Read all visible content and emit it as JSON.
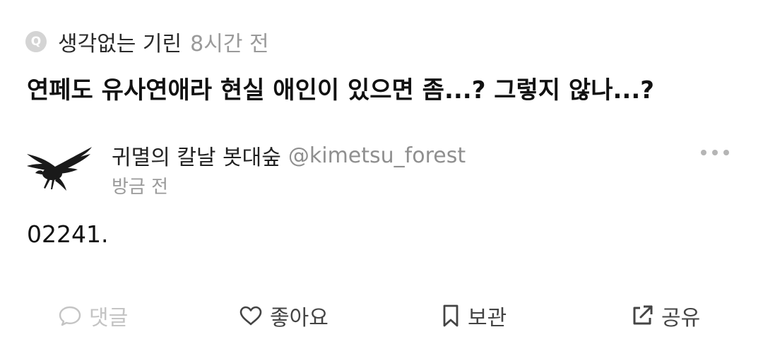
{
  "question": {
    "badge": "Q",
    "asker": "생각없는 기린",
    "time": "8시간 전",
    "text": "연페도 유사연애라 현실 애인이 있으면 좀...? 그렇지 않나...?"
  },
  "answer": {
    "author_name": "귀멸의 칼날 봇대숲",
    "author_handle": "@kimetsu_forest",
    "time": "방금 전",
    "text": "02241.",
    "avatar_icon": "crow-silhouette"
  },
  "actions": {
    "comment_label": "댓글",
    "like_label": "좋아요",
    "save_label": "보관",
    "share_label": "공유"
  },
  "colors": {
    "badge_bg": "#d4d4d4",
    "muted_text": "#9a9a9a",
    "disabled_action": "#c4c4c4",
    "action_text": "#444444"
  }
}
